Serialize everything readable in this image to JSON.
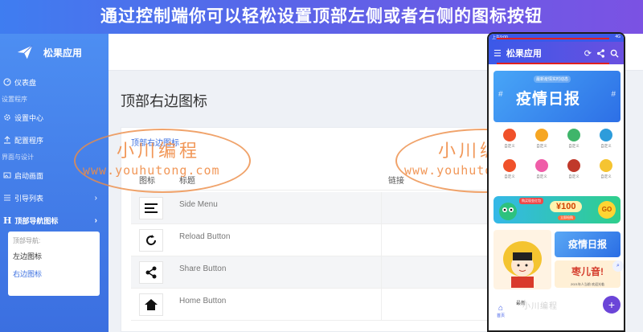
{
  "banner": {
    "text": "通过控制端你可以轻松设置顶部左侧或者右侧的图标按钮"
  },
  "sidebar": {
    "app_name": "松果应用",
    "items": [
      {
        "type": "item",
        "label": "仪表盘",
        "icon": "dashboard-icon"
      },
      {
        "type": "section",
        "label": "设置程序"
      },
      {
        "type": "item",
        "label": "设置中心",
        "icon": "gear-icon"
      },
      {
        "type": "item",
        "label": "配置程序",
        "icon": "upload-icon"
      },
      {
        "type": "section",
        "label": "界面与设计"
      },
      {
        "type": "item",
        "label": "启动画面",
        "icon": "image-icon"
      },
      {
        "type": "item",
        "label": "引导列表",
        "icon": "list-icon",
        "chevron": "›"
      },
      {
        "type": "item",
        "label": "顶部导航图标",
        "icon": "h-icon",
        "chevron": "›",
        "bold": true
      }
    ],
    "submenu": {
      "heading": "顶部导航:",
      "items": [
        {
          "label": "左边图标"
        },
        {
          "label": "右边图标",
          "active": true
        }
      ]
    }
  },
  "main": {
    "page_title": "顶部右边图标",
    "card_title": "顶部右边图标",
    "table": {
      "headers": [
        "图标",
        "标题",
        "链接"
      ],
      "rows": [
        {
          "icon": "menu-icon",
          "name": "Side Menu"
        },
        {
          "icon": "reload-icon",
          "name": "Reload Button"
        },
        {
          "icon": "share-icon",
          "name": "Share Button"
        },
        {
          "icon": "home-icon",
          "name": "Home Button"
        }
      ]
    }
  },
  "watermark": {
    "cn": "小川编程",
    "url": "www.youhutong.com"
  },
  "phone": {
    "status_left": "上午9:00",
    "status_right": "4G",
    "nav_title": "松果应用",
    "banner_small": "最新疫情实时动态",
    "banner_big": "疫情日报",
    "grid_label": "自定义",
    "grid_colors": [
      "#f0512a",
      "#f6a623",
      "#3fb56a",
      "#2d9cdb",
      "#f0512a",
      "#ef5da8",
      "#c0392b",
      "#f5c431"
    ],
    "coupon_tag": "购买现金红包",
    "coupon_amount": "¥100",
    "coupon_sub": "立即抢购",
    "coupon_go": "GO",
    "promo_r1": "疫情日报",
    "promo_r2": "枣儿音!",
    "promo_r2_foot": "2021年人当前 欢迎光临",
    "bottom_home": "首页",
    "bottom_latest": "最新",
    "fab": "+"
  },
  "bottom_watermark": "小川编程"
}
